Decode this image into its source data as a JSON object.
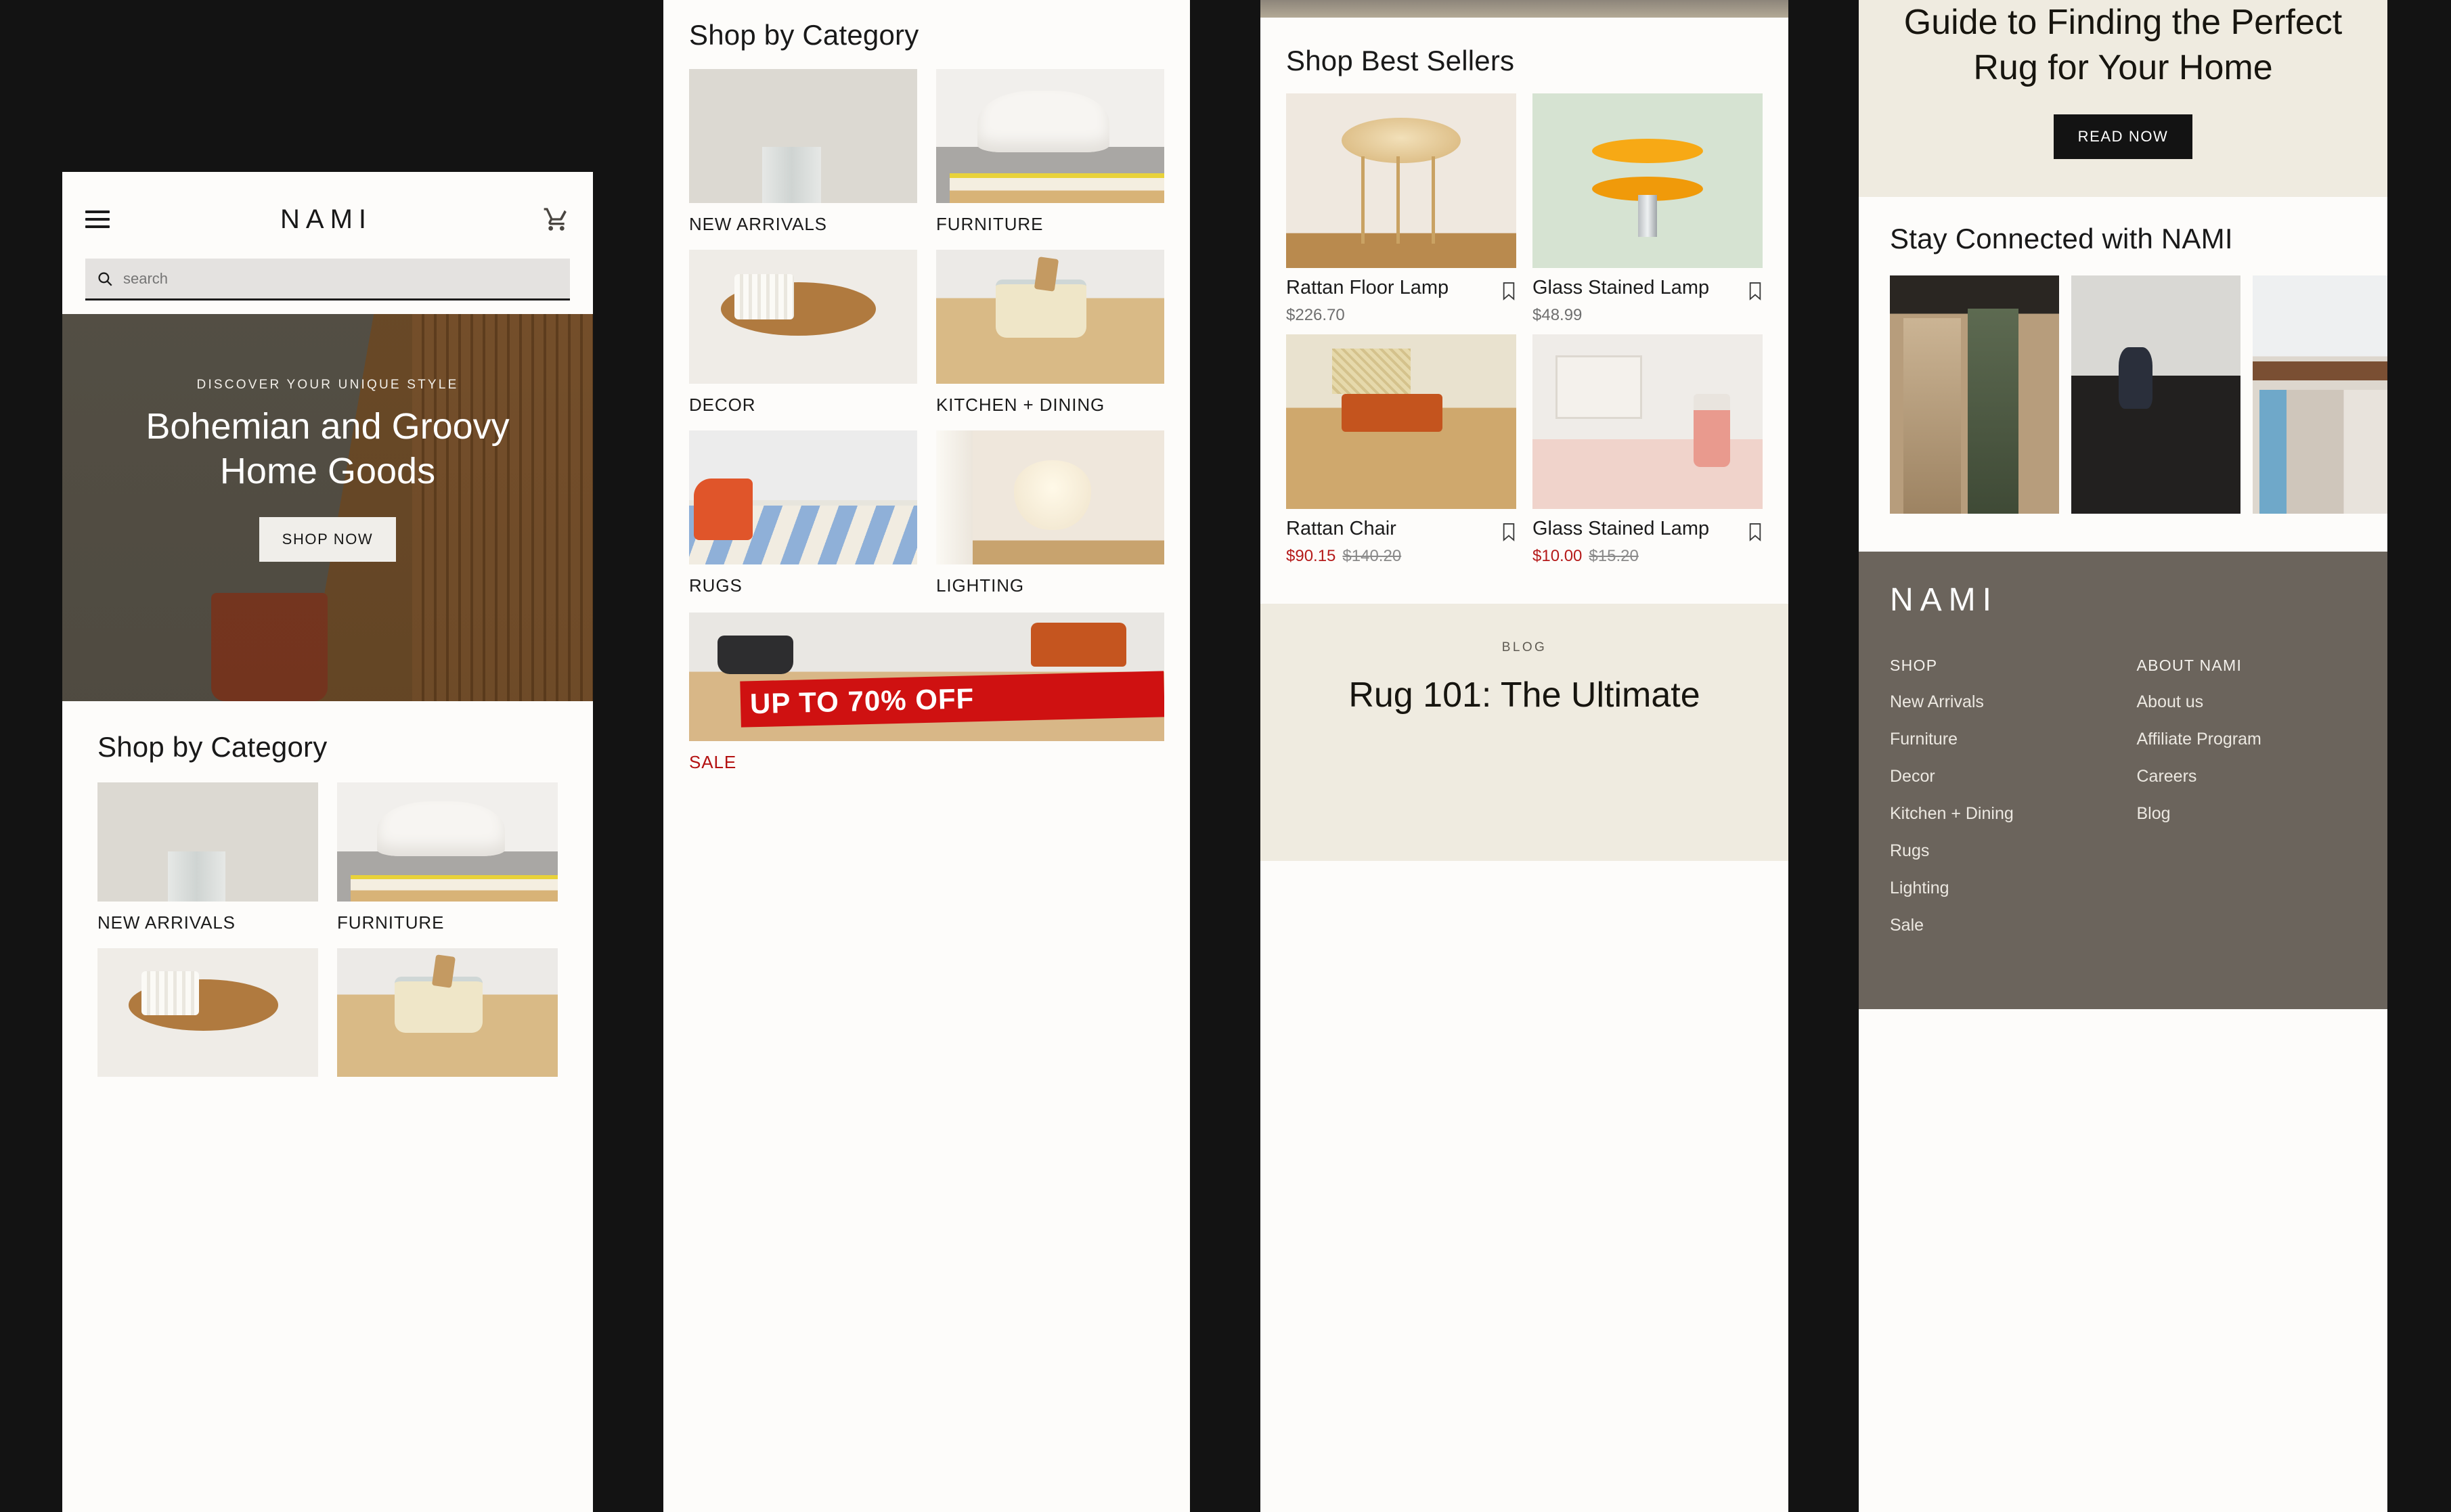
{
  "brand": "NAMI",
  "header": {
    "menu_icon": "hamburger-icon",
    "cart_icon": "shopping-cart-icon",
    "search_placeholder": "search",
    "search_value": ""
  },
  "hero": {
    "eyebrow": "DISCOVER YOUR UNIQUE STYLE",
    "title_line1": "Bohemian and Groovy",
    "title_line2": "Home Goods",
    "cta": "SHOP NOW"
  },
  "category_section": {
    "title": "Shop by Category",
    "items": [
      {
        "label": "NEW ARRIVALS",
        "art": "im-flowers"
      },
      {
        "label": "FURNITURE",
        "art": "im-chair"
      },
      {
        "label": "DECOR",
        "art": "im-candles"
      },
      {
        "label": "KITCHEN + DINING",
        "art": "im-kitchen"
      },
      {
        "label": "RUGS",
        "art": "im-rug"
      },
      {
        "label": "LIGHTING",
        "art": "im-light"
      }
    ]
  },
  "sale_promo": {
    "ribbon": "UP TO 70% OFF",
    "label": "SALE",
    "ribbon_color": "#cf1111",
    "label_color": "#b41212"
  },
  "best_sellers": {
    "title": "Shop Best Sellers",
    "products": [
      {
        "name": "Rattan Floor Lamp",
        "price": "$226.70",
        "was": "",
        "on_sale": false,
        "art": "im-rattan",
        "bookmark_icon": "bookmark-icon"
      },
      {
        "name": "Glass Stained Lamp",
        "price": "$48.99",
        "was": "",
        "on_sale": false,
        "art": "im-glass",
        "bookmark_icon": "bookmark-icon"
      },
      {
        "name": "Rattan Chair",
        "price": "$90.15",
        "was": "$140.20",
        "on_sale": true,
        "art": "im-rchair",
        "bookmark_icon": "bookmark-icon"
      },
      {
        "name": "Glass Stained Lamp",
        "price": "$10.00",
        "was": "$15.20",
        "on_sale": true,
        "art": "im-bath",
        "bookmark_icon": "bookmark-icon"
      }
    ]
  },
  "blog": {
    "kicker": "BLOG",
    "headline": "Rug 101: The Ultimate Guide to Finding the Perfect Rug for Your Home",
    "headline_part_top": "Rug 101: The Ultimate",
    "headline_part_rest": "Guide to Finding the Perfect Rug for Your Home",
    "cta": "READ NOW",
    "background": "#efebe0"
  },
  "social": {
    "title": "Stay Connected with NAMI",
    "tiles": [
      {
        "art": "im-coats"
      },
      {
        "art": "im-sofa"
      },
      {
        "art": "im-rack"
      }
    ]
  },
  "footer": {
    "brand": "NAMI",
    "background": "#6b645c",
    "columns": [
      {
        "heading": "SHOP",
        "links": [
          "New Arrivals",
          "Furniture",
          "Decor",
          "Kitchen + Dining",
          "Rugs",
          "Lighting",
          "Sale"
        ]
      },
      {
        "heading": "ABOUT NAMI",
        "links": [
          "About us",
          "Affiliate Program",
          "Careers",
          "Blog"
        ]
      }
    ]
  }
}
